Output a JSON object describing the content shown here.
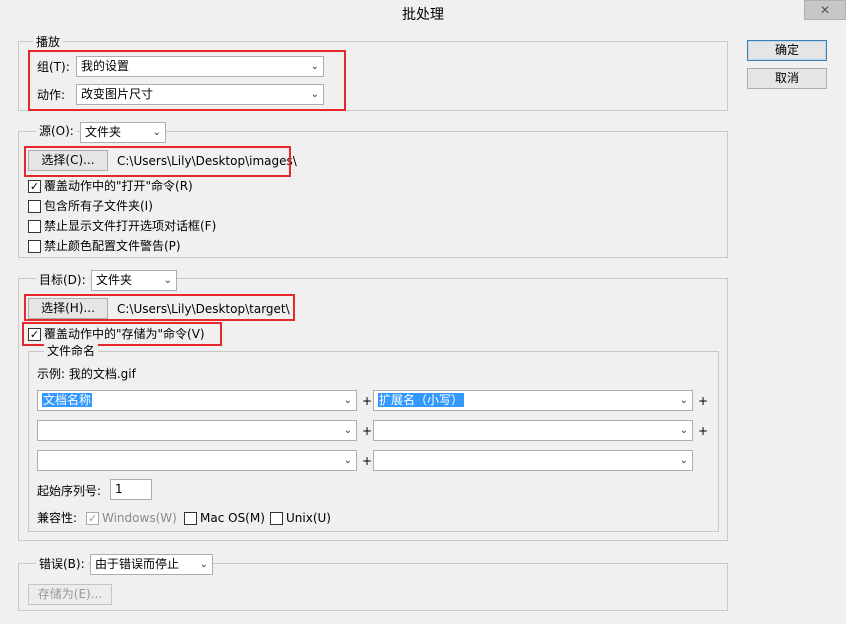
{
  "window": {
    "title": "批处理",
    "close_glyph": "✕"
  },
  "buttons": {
    "ok": "确定",
    "cancel": "取消"
  },
  "play": {
    "legend": "播放",
    "group_label": "组(T):",
    "group_value": "我的设置",
    "action_label": "动作:",
    "action_value": "改变图片尺寸"
  },
  "source": {
    "label": "源(O):",
    "value": "文件夹",
    "choose_button": "选择(C)...",
    "path": "C:\\Users\\Lily\\Desktop\\images\\",
    "options": [
      {
        "label": "覆盖动作中的\"打开\"命令(R)",
        "checked": true
      },
      {
        "label": "包含所有子文件夹(I)",
        "checked": false
      },
      {
        "label": "禁止显示文件打开选项对话框(F)",
        "checked": false
      },
      {
        "label": "禁止颜色配置文件警告(P)",
        "checked": false
      }
    ]
  },
  "target": {
    "label": "目标(D):",
    "value": "文件夹",
    "choose_button": "选择(H)...",
    "path": "C:\\Users\\Lily\\Desktop\\target\\",
    "override_save": {
      "label": "覆盖动作中的\"存储为\"命令(V)",
      "checked": true
    }
  },
  "naming": {
    "legend": "文件命名",
    "example": "示例: 我的文档.gif",
    "rows": [
      {
        "left": "文档名称",
        "right": "扩展名（小写）"
      },
      {
        "left": "",
        "right": ""
      },
      {
        "left": "",
        "right": ""
      }
    ],
    "plus": "+",
    "serial_label": "起始序列号:",
    "serial_value": "1",
    "compat_label": "兼容性:",
    "compat": [
      {
        "label": "Windows(W)",
        "checked": true,
        "disabled": true
      },
      {
        "label": "Mac OS(M)",
        "checked": false,
        "disabled": false
      },
      {
        "label": "Unix(U)",
        "checked": false,
        "disabled": false
      }
    ]
  },
  "errors": {
    "label": "错误(B):",
    "value": "由于错误而停止",
    "save_as_button": "存储为(E)..."
  },
  "colors": {
    "highlight_red": "#e8272d",
    "selection_blue": "#3399ff"
  }
}
